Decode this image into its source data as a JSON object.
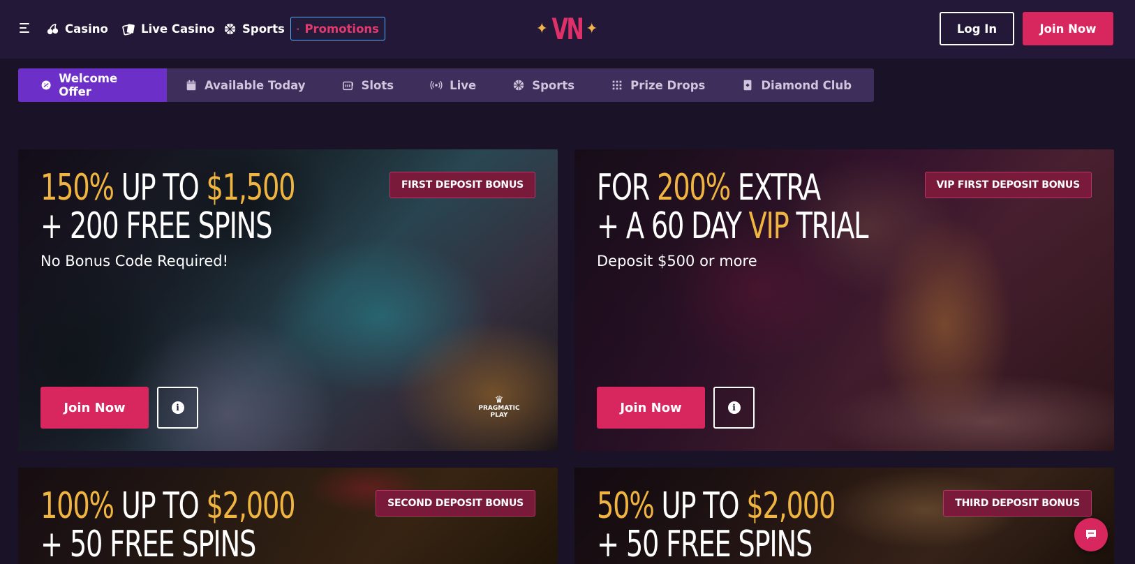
{
  "header": {
    "nav": [
      {
        "label": "Casino",
        "icon": "cherry-icon"
      },
      {
        "label": "Live Casino",
        "icon": "cards-icon"
      },
      {
        "label": "Sports",
        "icon": "ball-icon"
      },
      {
        "label": "Promotions",
        "icon": "gift-icon"
      }
    ],
    "logo": {
      "text": "VN",
      "star": "✦"
    },
    "login_label": "Log In",
    "join_label": "Join Now"
  },
  "tabs": [
    {
      "label": "Welcome Offer",
      "icon": "badge-icon",
      "active": true
    },
    {
      "label": "Available Today",
      "icon": "calendar-icon"
    },
    {
      "label": "Slots",
      "icon": "slot-icon"
    },
    {
      "label": "Live",
      "icon": "broadcast-icon"
    },
    {
      "label": "Sports",
      "icon": "ball-icon"
    },
    {
      "label": "Prize Drops",
      "icon": "grid-icon"
    },
    {
      "label": "Diamond Club",
      "icon": "card-icon"
    }
  ],
  "promos": [
    {
      "line1": {
        "a": "150%",
        "b": " UP TO ",
        "c": "$1,500"
      },
      "line2": {
        "a": "+ 200 FREE SPINS"
      },
      "subtitle": "No Bonus Code Required!",
      "badge": "FIRST DEPOSIT BONUS",
      "join_label": "Join Now",
      "provider": "PRAGMATIC PLAY"
    },
    {
      "line1": {
        "a": "FOR ",
        "b": "200%",
        "c": " EXTRA"
      },
      "line2": {
        "a": "+ A 60 DAY ",
        "b": "VIP",
        "c": " TRIAL"
      },
      "subtitle": "Deposit $500 or more",
      "badge": "VIP FIRST DEPOSIT BONUS",
      "join_label": "Join Now"
    },
    {
      "line1": {
        "a": "100%",
        "b": " UP TO ",
        "c": "$2,000"
      },
      "line2": {
        "a": "+ 50 FREE SPINS"
      },
      "badge": "SECOND DEPOSIT BONUS"
    },
    {
      "line1": {
        "a": "50%",
        "b": " UP TO ",
        "c": "$2,000"
      },
      "line2": {
        "a": "+ 50 FREE SPINS"
      },
      "badge": "THIRD DEPOSIT BONUS"
    }
  ],
  "colors": {
    "accent": "#d8275f",
    "gold": "#f0b440",
    "tab_active": "#6c30c9"
  }
}
